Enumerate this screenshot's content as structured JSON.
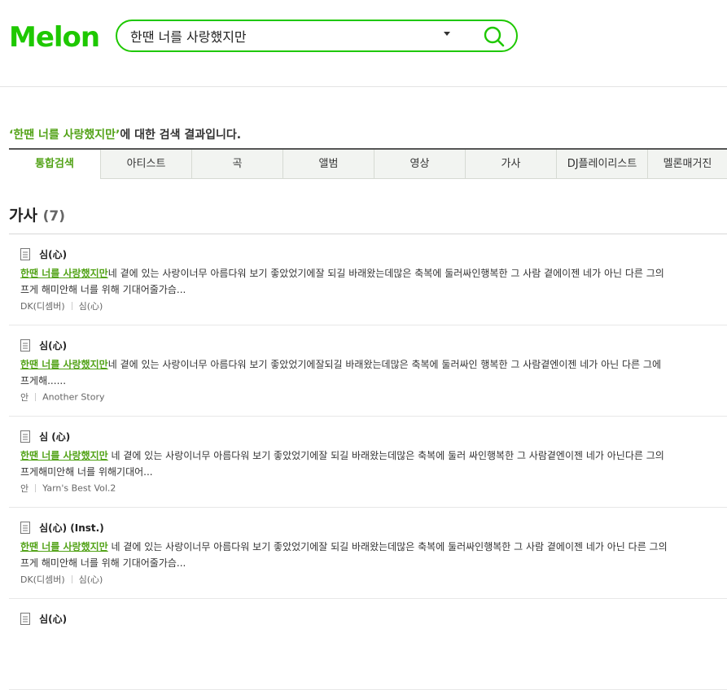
{
  "header": {
    "logo": "Melon",
    "search": {
      "value": "한땐 너를 사랑했지만",
      "placeholder": ""
    }
  },
  "result": {
    "keyword": "‘한땐 너를 사랑했지만’",
    "suffix": "에 대한 검색 결과입니다."
  },
  "tabs": [
    {
      "label": "통합검색",
      "active": true
    },
    {
      "label": "아티스트"
    },
    {
      "label": "곡"
    },
    {
      "label": "앨범"
    },
    {
      "label": "영상"
    },
    {
      "label": "가사"
    },
    {
      "label": "DJ플레이리스트"
    },
    {
      "label": "멜론매거진"
    }
  ],
  "section": {
    "title": "가사",
    "count": "(7)"
  },
  "items": [
    {
      "title": "심(心)",
      "highlight": "한땐 너를 사랑했지만",
      "lyrics1": "네 곁에 있는 사랑이너무 아름다워 보기 좋았었기에잘 되길 바래왔는데많은 축복에 둘러싸인행복한 그 사람 곁에이젠 네가 아닌 다른 그의",
      "lyrics2": "프게 해미안해 너를 위해 기대어줄가슴...",
      "artist": "DK(디셈버)",
      "album": "심(心)"
    },
    {
      "title": "심(心)",
      "highlight": "한땐 너를 사랑했지만",
      "lyrics1": "네 곁에 있는 사랑이너무 아름다워 보기 좋았었기에잘되길 바래왔는데많은 축복에 둘러싸인 행복한 그 사람곁엔이젠 네가 아닌 다른 그에",
      "lyrics2": "프게해......",
      "artist": "안",
      "album": "Another Story"
    },
    {
      "title": "심 (心)",
      "highlight": "한땐 너를 사랑했지만",
      "lyrics1": " 네 곁에 있는 사랑이너무 아름다워 보기 좋았었기에잘 되길 바래왔는데많은 축복에 둘러 싸인행복한 그 사람곁엔이젠 네가 아닌다른 그의",
      "lyrics2": "프게해미안해 너를 위해기대어...",
      "artist": "안",
      "album": "Yarn's Best Vol.2"
    },
    {
      "title": "심(心) (Inst.)",
      "highlight": "한땐 너를 사랑했지만",
      "lyrics1": " 네 곁에 있는 사랑이너무 아름다워 보기 좋았었기에잘 되길 바래왔는데많은 축복에 둘러싸인행복한 그 사람 곁에이젠 네가 아닌 다른 그의",
      "lyrics2": "프게 해미안해 너를 위해 기대어줄가슴...",
      "artist": "DK(디셈버)",
      "album": "심(心)"
    },
    {
      "title": "심(心)",
      "highlight": "",
      "lyrics1": "",
      "lyrics2": "",
      "artist": "",
      "album": ""
    }
  ],
  "colors": {
    "brand": "#1ec800",
    "keyword": "#53a318"
  }
}
